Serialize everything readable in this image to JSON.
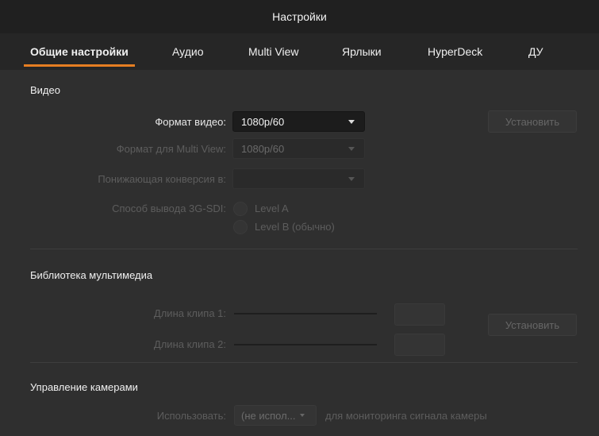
{
  "window": {
    "title": "Настройки"
  },
  "tabs": [
    {
      "label": "Общие настройки",
      "active": true
    },
    {
      "label": "Аудио",
      "active": false
    },
    {
      "label": "Multi View",
      "active": false
    },
    {
      "label": "Ярлыки",
      "active": false
    },
    {
      "label": "HyperDeck",
      "active": false
    },
    {
      "label": "ДУ",
      "active": false
    }
  ],
  "video": {
    "title": "Видео",
    "format_label": "Формат видео:",
    "format_value": "1080p/60",
    "set_button": "Установить",
    "multiview_label": "Формат для Multi View:",
    "multiview_value": "1080p/60",
    "downconvert_label": "Понижающая конверсия в:",
    "downconvert_value": "",
    "sdi_label": "Способ вывода 3G-SDI:",
    "level_a": "Level A",
    "level_b": "Level B (обычно)"
  },
  "media": {
    "title": "Библиотека мультимедиа",
    "clip1_label": "Длина клипа 1:",
    "clip2_label": "Длина клипа 2:",
    "set_button": "Установить"
  },
  "camera": {
    "title": "Управление камерами",
    "use_label": "Использовать:",
    "use_value": "(не испол...",
    "hint": "для мониторинга сигнала камеры"
  },
  "colors": {
    "accent": "#e67e22"
  }
}
